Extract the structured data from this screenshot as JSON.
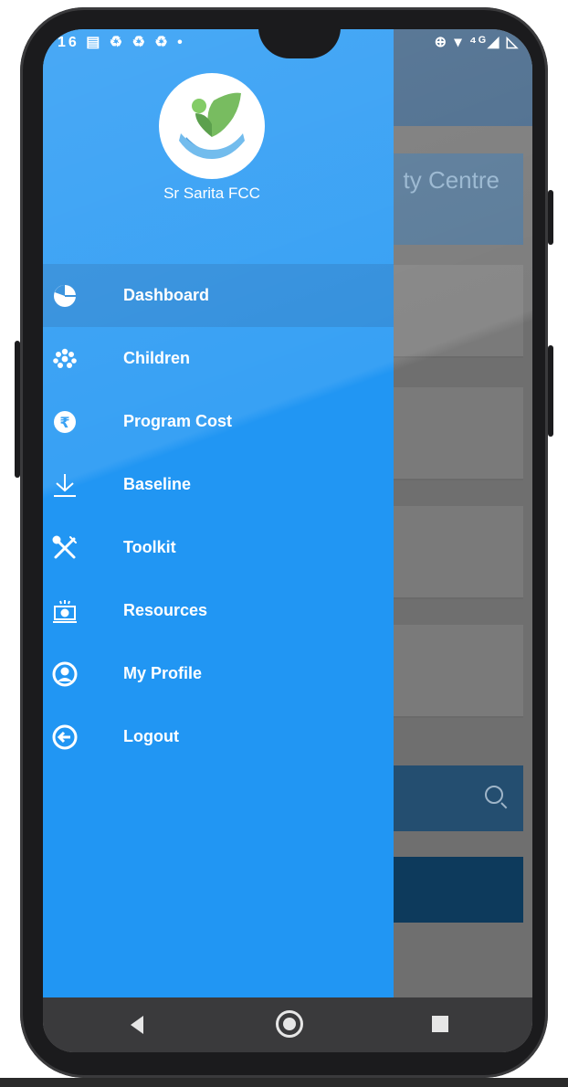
{
  "status_bar": {
    "left_text": "16 ▤ ♻ ♻ ♻ •",
    "right_text": "⊕ ▾ ⁴ᴳ◢ ◺"
  },
  "background_app": {
    "title_fragment": "ty Centre"
  },
  "drawer": {
    "header": {
      "name": "Sr Sarita FCC"
    },
    "items": [
      {
        "label": "Dashboard",
        "icon": "pie-chart-icon",
        "selected": true
      },
      {
        "label": "Children",
        "icon": "children-group-icon"
      },
      {
        "label": "Program Cost",
        "icon": "rupee-icon"
      },
      {
        "label": "Baseline",
        "icon": "download-icon"
      },
      {
        "label": "Toolkit",
        "icon": "tools-icon"
      },
      {
        "label": "Resources",
        "icon": "resources-icon"
      },
      {
        "label": "My Profile",
        "icon": "profile-icon"
      },
      {
        "label": "Logout",
        "icon": "logout-icon"
      }
    ]
  },
  "colors": {
    "drawer": "#2196f3",
    "selected": "#1e84d9",
    "toolbar": "#3b5f83",
    "navbar": "#3a3a3c"
  }
}
